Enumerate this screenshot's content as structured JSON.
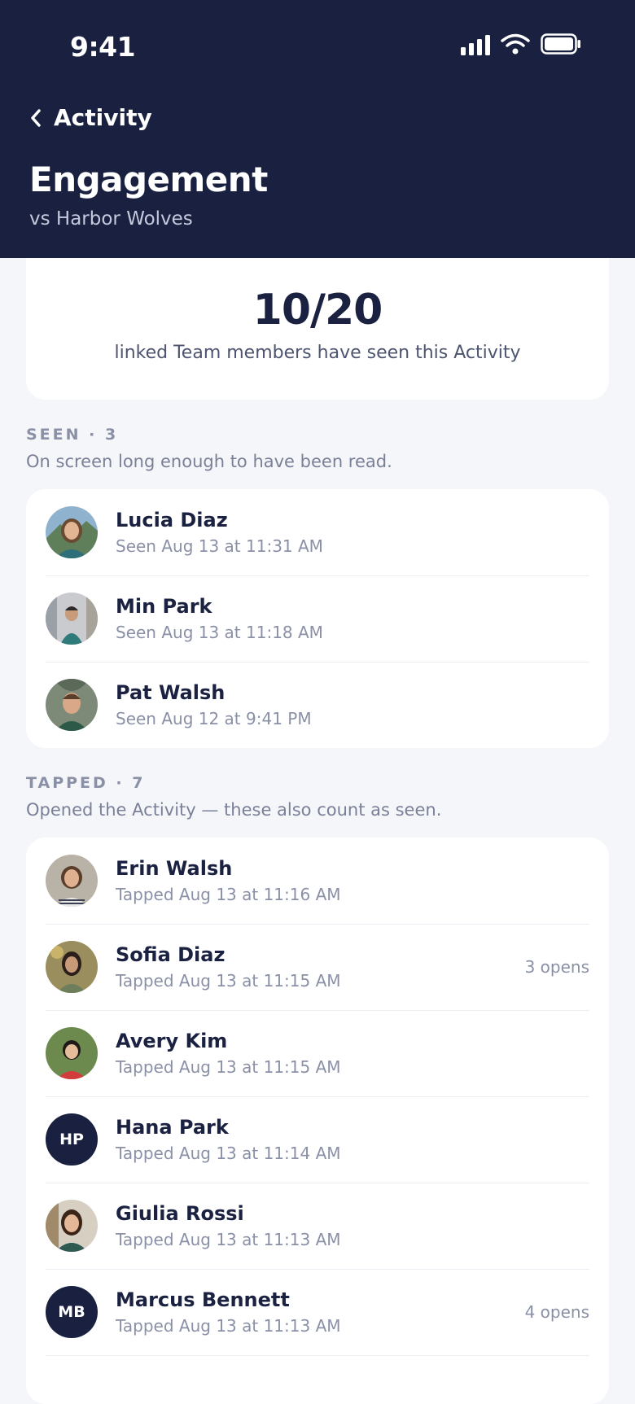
{
  "status": {
    "time": "9:41"
  },
  "nav": {
    "back_label": "Activity"
  },
  "page": {
    "title": "Engagement",
    "subtitle": "vs Harbor Wolves"
  },
  "summary": {
    "value": "10/20",
    "caption": "linked Team members have seen this Activity"
  },
  "seen": {
    "label": "SEEN · 3",
    "description": "On screen long enough to have been read.",
    "items": [
      {
        "name": "Lucia Diaz",
        "detail": "Seen Aug 13 at 11:31 AM"
      },
      {
        "name": "Min Park",
        "detail": "Seen Aug 13 at 11:18 AM"
      },
      {
        "name": "Pat Walsh",
        "detail": "Seen Aug 12 at 9:41 PM"
      }
    ]
  },
  "tapped": {
    "label": "TAPPED · 7",
    "description": "Opened the Activity — these also count as seen.",
    "items": [
      {
        "name": "Erin Walsh",
        "detail": "Tapped Aug 13 at 11:16 AM",
        "meta": ""
      },
      {
        "name": "Sofia Diaz",
        "detail": "Tapped Aug 13 at 11:15 AM",
        "meta": "3 opens"
      },
      {
        "name": "Avery Kim",
        "detail": "Tapped Aug 13 at 11:15 AM",
        "meta": ""
      },
      {
        "name": "Hana Park",
        "detail": "Tapped Aug 13 at 11:14 AM",
        "meta": "",
        "initials": "HP"
      },
      {
        "name": "Giulia Rossi",
        "detail": "Tapped Aug 13 at 11:13 AM",
        "meta": ""
      },
      {
        "name": "Marcus Bennett",
        "detail": "Tapped Aug 13 at 11:13 AM",
        "meta": "4 opens",
        "initials": "MB"
      }
    ]
  },
  "colors": {
    "header_bg": "#1a2040",
    "page_bg": "#f5f6f9",
    "card_bg": "#ffffff",
    "muted_text": "#8a90a6"
  }
}
